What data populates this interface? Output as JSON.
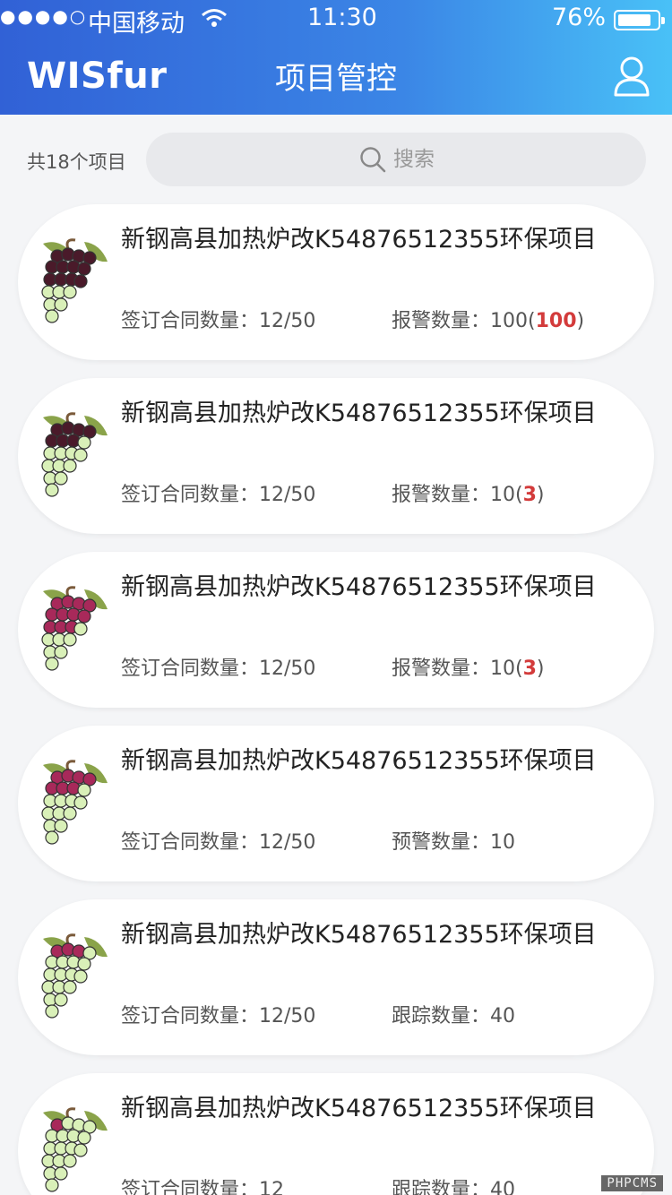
{
  "status_bar": {
    "signal": "●●●●○",
    "carrier": "中国移动",
    "time": "11:30",
    "battery_pct": "76%"
  },
  "header": {
    "logo": "WISfur",
    "title": "项目管控"
  },
  "toolbar": {
    "count_text": "共18个项目",
    "search_placeholder": "搜索"
  },
  "cards": [
    {
      "name": "新钢高县加热炉改K54876512355环保项目",
      "contracts": "签订合同数量：12/50",
      "metric_label": "报警数量：",
      "metric_value": "100(",
      "metric_red": "100",
      "metric_tail": ")"
    },
    {
      "name": "新钢高县加热炉改K54876512355环保项目",
      "contracts": "签订合同数量：12/50",
      "metric_label": "报警数量：",
      "metric_value": "10(",
      "metric_red": "3",
      "metric_tail": ")"
    },
    {
      "name": "新钢高县加热炉改K54876512355环保项目",
      "contracts": "签订合同数量：12/50",
      "metric_label": "报警数量：",
      "metric_value": "10(",
      "metric_red": "3",
      "metric_tail": ")"
    },
    {
      "name": "新钢高县加热炉改K54876512355环保项目",
      "contracts": "签订合同数量：12/50",
      "metric_label": "预警数量：",
      "metric_value": "10",
      "metric_red": "",
      "metric_tail": ""
    },
    {
      "name": "新钢高县加热炉改K54876512355环保项目",
      "contracts": "签订合同数量：12/50",
      "metric_label": "跟踪数量：",
      "metric_value": "40",
      "metric_red": "",
      "metric_tail": ""
    },
    {
      "name": "新钢高县加热炉改K54876512355环保项目",
      "contracts": "签订合同数量：12",
      "metric_label": "跟踪数量：",
      "metric_value": "40",
      "metric_red": "",
      "metric_tail": ""
    }
  ],
  "watermark": "PHPCMS",
  "colors": {
    "header_start": "#3161d6",
    "header_end": "#49c1f7",
    "alert_red": "#d33b3b"
  }
}
